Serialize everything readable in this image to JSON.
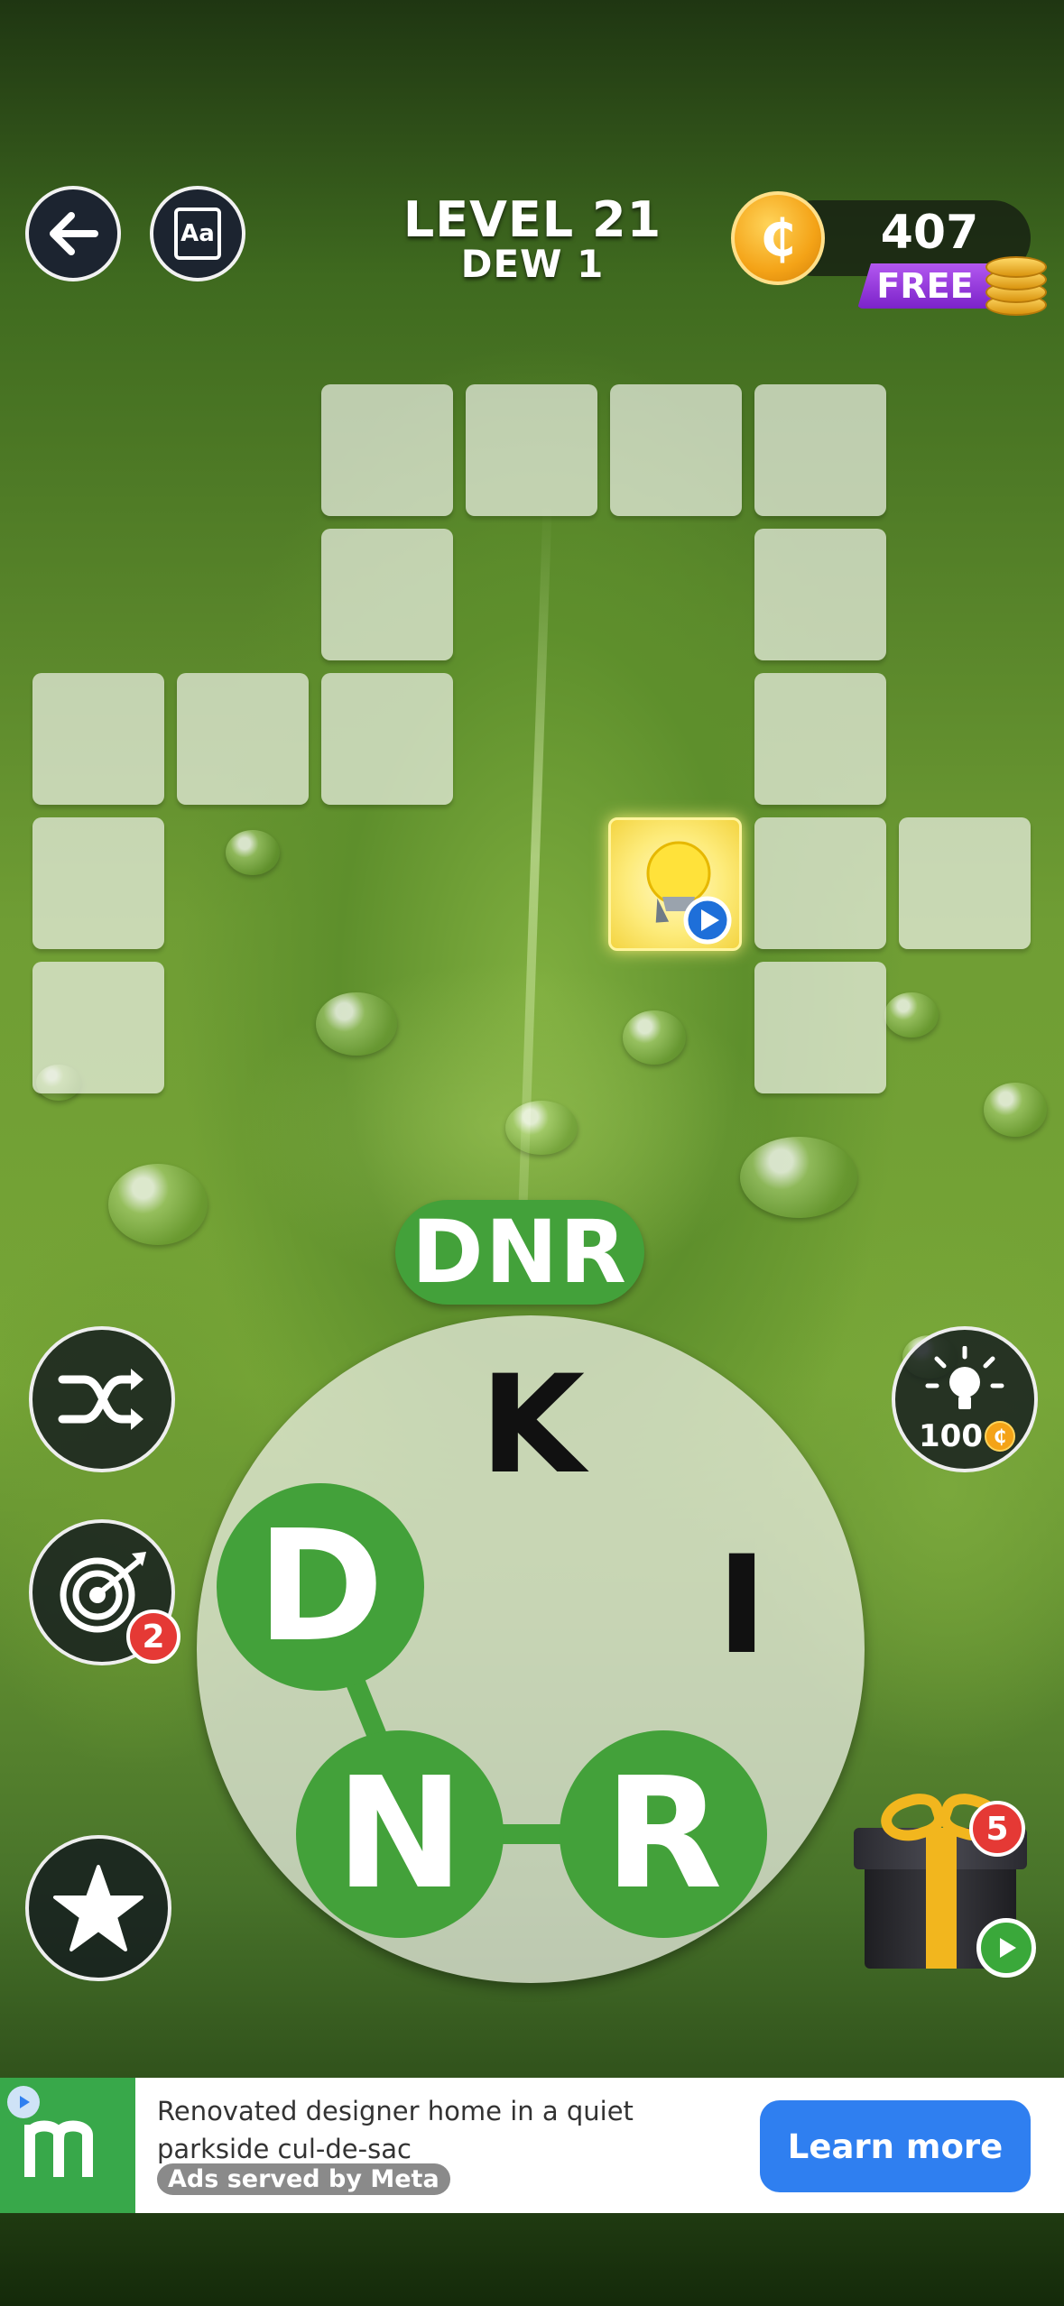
{
  "header": {
    "level_title": "LEVEL 21",
    "level_subtitle": "DEW 1",
    "coins": "407",
    "coin_symbol": "₵",
    "free_label": "FREE",
    "back_icon": "arrow-left-icon",
    "dictionary_label": "Aa"
  },
  "grid": {
    "hint_cell_icon": "lightbulb-play-icon"
  },
  "word_preview": "DNR",
  "wheel": {
    "letters": [
      "K",
      "I",
      "D",
      "N",
      "R"
    ],
    "selected": [
      "D",
      "N",
      "R"
    ]
  },
  "side_buttons": {
    "shuffle_icon": "shuffle-icon",
    "target_icon": "target-icon",
    "target_badge": "2",
    "star_icon": "star-icon",
    "hint_icon": "lightbulb-icon",
    "hint_cost": "100",
    "gift_badge": "5"
  },
  "ad": {
    "text": "Renovated designer home in a quiet parkside cul-de-sac",
    "source": "Ads served by Meta",
    "cta": "Learn more",
    "accent": "#2f7ff0",
    "brand_color": "#38a84a"
  },
  "colors": {
    "selected_letter": "#43a13a",
    "coin": "#f4a317",
    "free_tag": "#8e35d8",
    "badge": "#e53935"
  }
}
